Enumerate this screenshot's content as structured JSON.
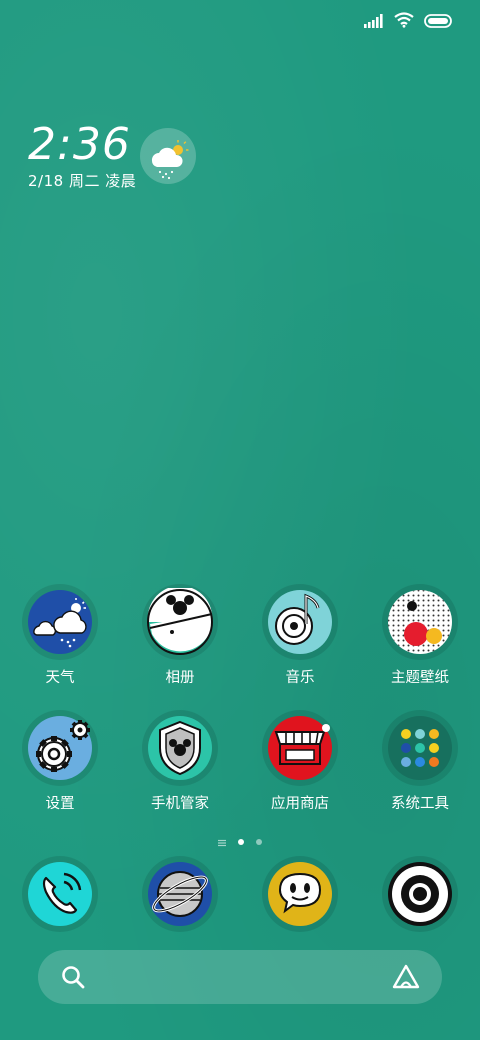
{
  "status_bar": {
    "signal": "signal-icon",
    "wifi": "wifi-icon",
    "battery": "battery-icon"
  },
  "clock": {
    "time": "2:36",
    "date": "2/18 周二 凌晨"
  },
  "weather_widget": {
    "icon": "snow-cloud-sun-icon"
  },
  "apps_row1": [
    {
      "label": "天气",
      "icon": "weather-icon"
    },
    {
      "label": "相册",
      "icon": "gallery-icon"
    },
    {
      "label": "音乐",
      "icon": "music-icon"
    },
    {
      "label": "主题壁纸",
      "icon": "themes-icon"
    }
  ],
  "apps_row2": [
    {
      "label": "设置",
      "icon": "settings-icon"
    },
    {
      "label": "手机管家",
      "icon": "security-icon"
    },
    {
      "label": "应用商店",
      "icon": "app-store-icon"
    },
    {
      "label": "系统工具",
      "icon": "system-tools-folder-icon"
    }
  ],
  "dock": [
    {
      "icon": "phone-icon"
    },
    {
      "icon": "browser-icon"
    },
    {
      "icon": "messages-icon"
    },
    {
      "icon": "camera-icon"
    }
  ],
  "page_indicator": {
    "pages": 3,
    "current": 1
  },
  "search": {
    "left_icon": "search-icon",
    "right_icon": "assistant-icon"
  }
}
